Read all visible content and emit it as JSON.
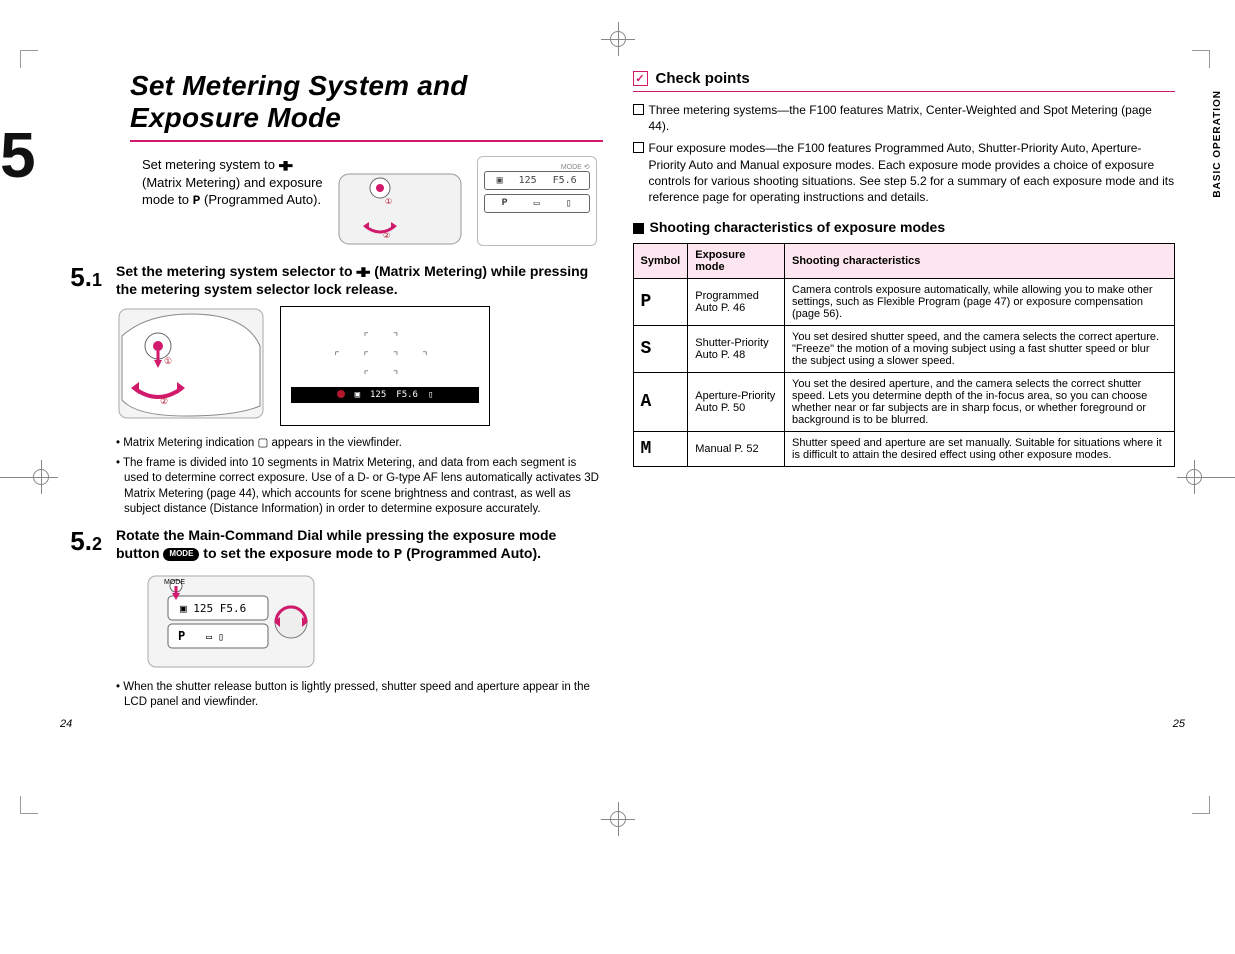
{
  "page": {
    "left_num": "24",
    "right_num": "25",
    "side_tab": "BASIC OPERATION",
    "big_step": "5"
  },
  "title": "Set Metering System and Exposure Mode",
  "intro": {
    "line1": "Set metering system to ",
    "line2": "(Matrix Metering) and exposure",
    "line3": "mode to ",
    "mode_char": "P",
    "line3b": " (Programmed Auto)."
  },
  "lcd": {
    "a": "125",
    "b": "F5.6",
    "c": "P"
  },
  "step51": {
    "num": "5.",
    "sub": "1",
    "head_a": "Set the metering system selector to ",
    "head_b": " (Matrix Metering) while pressing the metering system selector lock release.",
    "vf_bar_a": "125",
    "vf_bar_b": "F5.6",
    "bullets": [
      "• Matrix Metering indication ▢ appears in the viewfinder.",
      "• The frame is divided into 10 segments in Matrix Metering, and data from each segment is used to determine correct exposure. Use of a D- or G-type AF lens automatically activates 3D Matrix Metering (page 44), which accounts for scene brightness and contrast, as well as subject distance (Distance Information) in order to determine exposure accurately."
    ]
  },
  "step52": {
    "num": "5.",
    "sub": "2",
    "head_a": "Rotate the Main-Command Dial while pressing the exposure mode button ",
    "mode_label": "MODE",
    "head_b": " to set the exposure mode to ",
    "mode_char": "P",
    "head_c": " (Programmed Auto).",
    "note": "• When the shutter release button is lightly pressed, shutter speed and aperture appear in the LCD panel and viewfinder."
  },
  "check": {
    "title": "Check points",
    "items": [
      "Three metering systems—the F100 features Matrix, Center-Weighted and Spot Metering (page 44).",
      "Four exposure modes—the F100 features Programmed Auto, Shutter-Priority Auto, Aperture-Priority Auto and Manual exposure modes. Each exposure mode provides a choice of exposure controls for various shooting situations. See step 5.2 for a summary of each exposure mode and its reference page for operating instructions and details."
    ]
  },
  "table": {
    "section_title": "Shooting characteristics of exposure modes",
    "headers": {
      "c1": "Symbol",
      "c2": "Exposure mode",
      "c3": "Shooting characteristics"
    },
    "rows": [
      {
        "sym": "P",
        "mode": "Programmed Auto P. 46",
        "desc": "Camera controls exposure automatically, while allowing you to make other settings, such as Flexible Program (page 47) or exposure compensation (page 56)."
      },
      {
        "sym": "S",
        "mode": "Shutter-Priority Auto P. 48",
        "desc": "You set desired shutter speed, and the camera selects the correct aperture. \"Freeze\" the motion of a moving subject using a fast shutter speed or blur the subject using a slower speed."
      },
      {
        "sym": "A",
        "mode": "Aperture-Priority Auto P. 50",
        "desc": "You set the desired aperture, and the camera selects the correct shutter speed. Lets you determine depth of the in-focus area, so you can choose whether near or far subjects are in sharp focus, or whether foreground or background is to be blurred."
      },
      {
        "sym": "M",
        "mode": "Manual P. 52",
        "desc": "Shutter speed and aperture are set manually. Suitable for situations where it is difficult to attain the desired effect using other exposure modes."
      }
    ]
  }
}
